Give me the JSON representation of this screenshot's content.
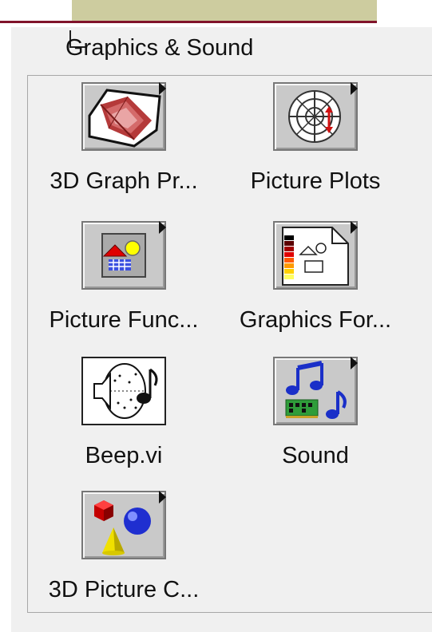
{
  "palette": {
    "title": "Graphics & Sound"
  },
  "items": [
    {
      "label": "3D Graph Pr...",
      "icon": "3d-graph-icon",
      "has_submenu": true
    },
    {
      "label": "Picture Plots",
      "icon": "polar-plot-icon",
      "has_submenu": true
    },
    {
      "label": "Picture Func...",
      "icon": "picture-functions-icon",
      "has_submenu": true
    },
    {
      "label": "Graphics For...",
      "icon": "graphics-formats-icon",
      "has_submenu": true
    },
    {
      "label": "Beep.vi",
      "icon": "beep-speaker-icon",
      "has_submenu": false
    },
    {
      "label": "Sound",
      "icon": "music-note-icon",
      "has_submenu": true
    },
    {
      "label": "3D Picture C...",
      "icon": "3d-shapes-icon",
      "has_submenu": true
    }
  ],
  "colors": {
    "panel_background": "#f0f0f0",
    "top_bar": "#cdcc9f",
    "accent_line": "#80132a"
  }
}
